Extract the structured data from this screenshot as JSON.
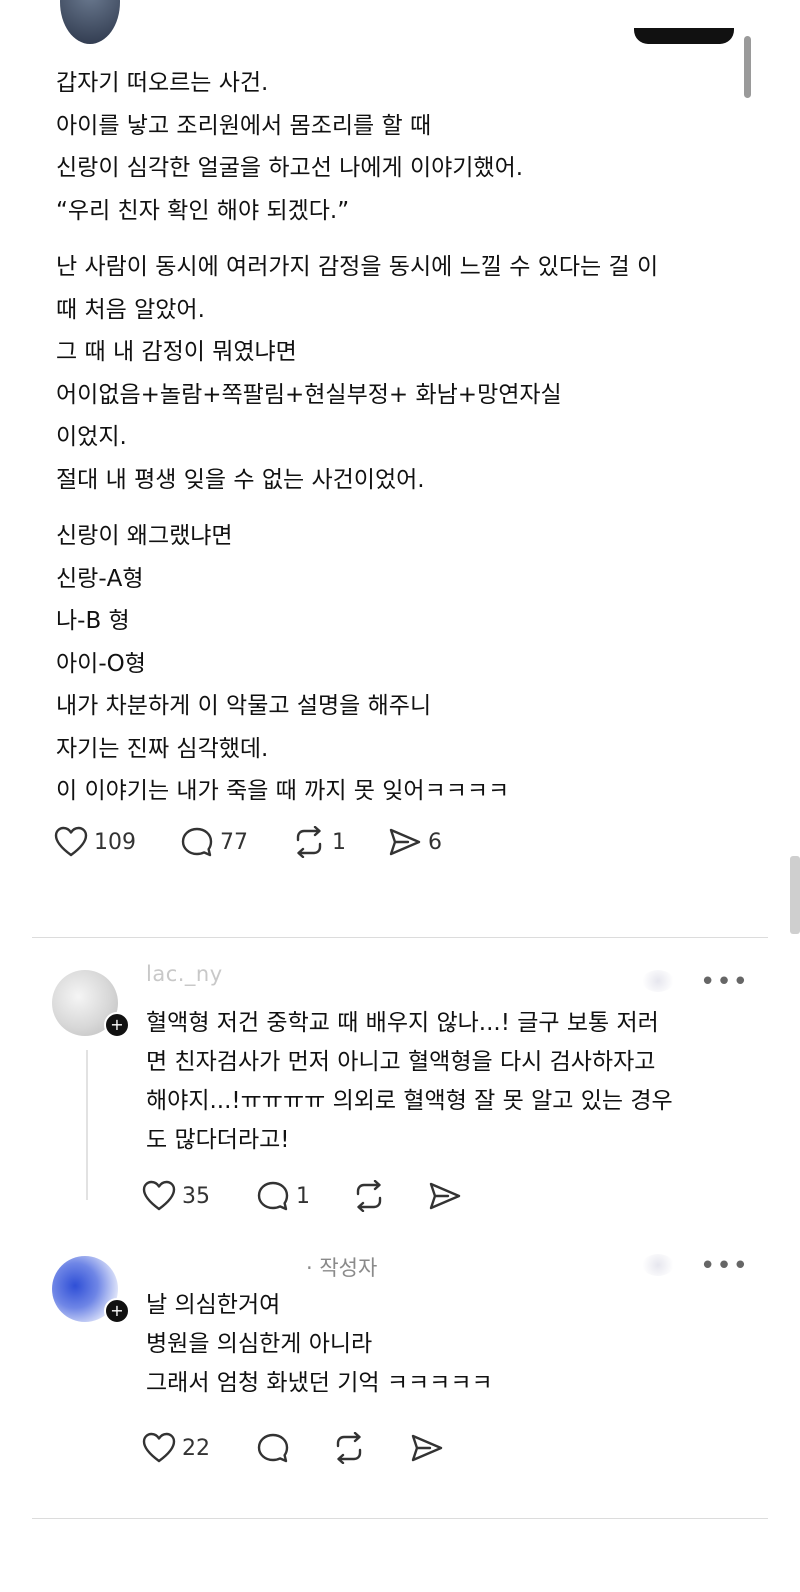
{
  "post": {
    "paragraphs": [
      [
        "갑자기 떠오르는 사건.",
        "아이를 낳고 조리원에서 몸조리를 할 때",
        "신랑이 심각한 얼굴을 하고선 나에게 이야기했어.",
        "“우리 친자 확인 해야 되겠다.”"
      ],
      [
        "난 사람이 동시에 여러가지 감정을 동시에 느낄 수 있다는 걸 이",
        "때 처음 알았어.",
        "그 때 내 감정이 뭐였냐면",
        "어이없음+놀람+쪽팔림+현실부정+ 화남+망연자실",
        "이었지.",
        "절대 내 평생 잊을 수 없는 사건이었어."
      ],
      [
        "신랑이 왜그랬냐면",
        "신랑-A형",
        "나-B 형",
        "아이-O형",
        "내가 차분하게 이 악물고 설명을 해주니",
        "자기는 진짜 심각했데.",
        "이 이야기는 내가 죽을 때 까지 못 잊어ㅋㅋㅋㅋ"
      ]
    ],
    "likes": "109",
    "replies": "77",
    "reposts": "1",
    "shares": "6"
  },
  "comments": [
    {
      "username": "lac._ny",
      "lines": [
        "혈액형 저건 중학교 때 배우지 않나...! 글구 보통 저러",
        "면 친자검사가 먼저 아니고 혈액형을 다시 검사하자고",
        "해야지...!ㅠㅠㅠㅠ 의외로 혈액형 잘 못 알고 있는 경우",
        "도 많다더라고!"
      ],
      "likes": "35",
      "replies": "1"
    },
    {
      "author_tag": "· 작성자",
      "lines": [
        "날 의심한거여",
        "병원을 의심한게 아니라",
        "그래서 엄청 화냈던 기억 ㅋㅋㅋㅋㅋ"
      ],
      "likes": "22"
    }
  ],
  "more_label": "•••",
  "badge_label": "+",
  "icons": {
    "like": "heart-icon",
    "reply": "speech-bubble-icon",
    "repost": "repost-icon",
    "share": "send-icon"
  }
}
